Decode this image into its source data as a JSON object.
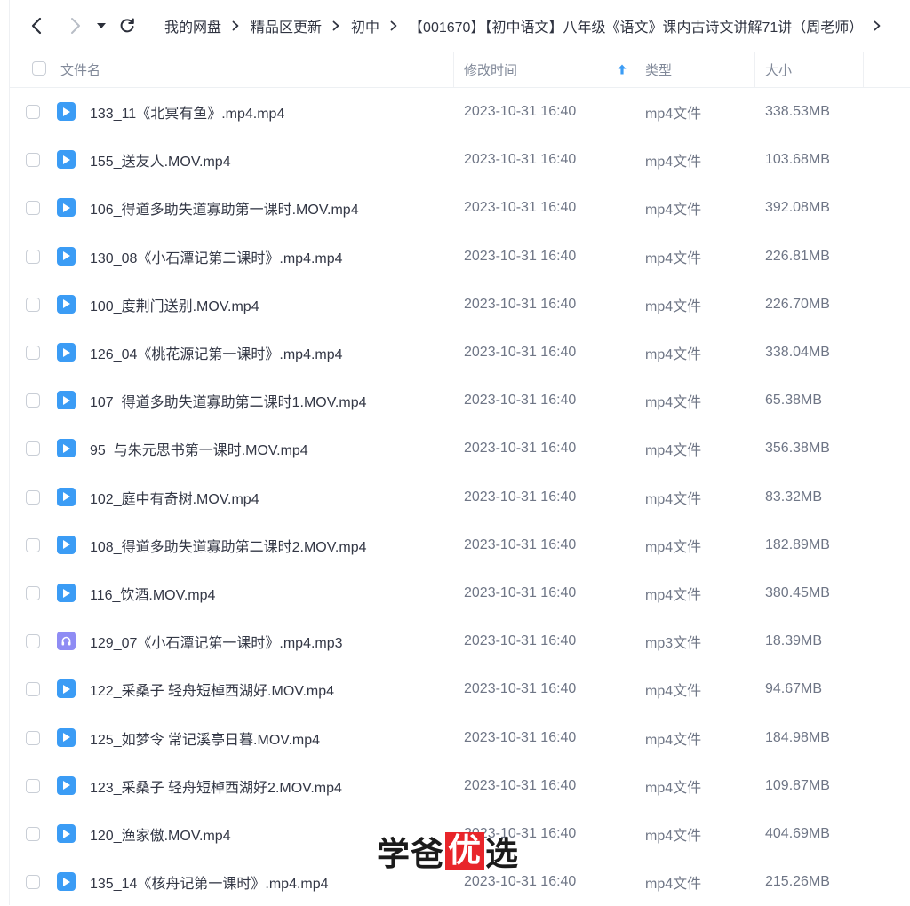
{
  "nav": {
    "breadcrumbs": [
      "我的网盘",
      "精品区更新",
      "初中",
      "【001670】【初中语文】八年级《语文》课内古诗文讲解71讲（周老师）"
    ]
  },
  "columns": {
    "name": "文件名",
    "modified": "修改时间",
    "type": "类型",
    "size": "大小"
  },
  "colors": {
    "video_icon": "#3b9cf5",
    "audio_icon": "#8f8cf4",
    "sort_arrow": "#3b9cf5",
    "watermark_highlight": "#e8252a"
  },
  "files": [
    {
      "name": "133_11《北冥有鱼》.mp4.mp4",
      "modified": "2023-10-31 16:40",
      "type": "mp4文件",
      "size": "338.53MB",
      "icon": "video-file-icon"
    },
    {
      "name": "155_送友人.MOV.mp4",
      "modified": "2023-10-31 16:40",
      "type": "mp4文件",
      "size": "103.68MB",
      "icon": "video-file-icon"
    },
    {
      "name": "106_得道多助失道寡助第一课时.MOV.mp4",
      "modified": "2023-10-31 16:40",
      "type": "mp4文件",
      "size": "392.08MB",
      "icon": "video-file-icon"
    },
    {
      "name": "130_08《小石潭记第二课时》.mp4.mp4",
      "modified": "2023-10-31 16:40",
      "type": "mp4文件",
      "size": "226.81MB",
      "icon": "video-file-icon"
    },
    {
      "name": "100_度荆门送别.MOV.mp4",
      "modified": "2023-10-31 16:40",
      "type": "mp4文件",
      "size": "226.70MB",
      "icon": "video-file-icon"
    },
    {
      "name": "126_04《桃花源记第一课时》.mp4.mp4",
      "modified": "2023-10-31 16:40",
      "type": "mp4文件",
      "size": "338.04MB",
      "icon": "video-file-icon"
    },
    {
      "name": "107_得道多助失道寡助第二课时1.MOV.mp4",
      "modified": "2023-10-31 16:40",
      "type": "mp4文件",
      "size": "65.38MB",
      "icon": "video-file-icon"
    },
    {
      "name": "95_与朱元思书第一课时.MOV.mp4",
      "modified": "2023-10-31 16:40",
      "type": "mp4文件",
      "size": "356.38MB",
      "icon": "video-file-icon"
    },
    {
      "name": "102_庭中有奇树.MOV.mp4",
      "modified": "2023-10-31 16:40",
      "type": "mp4文件",
      "size": "83.32MB",
      "icon": "video-file-icon"
    },
    {
      "name": "108_得道多助失道寡助第二课时2.MOV.mp4",
      "modified": "2023-10-31 16:40",
      "type": "mp4文件",
      "size": "182.89MB",
      "icon": "video-file-icon"
    },
    {
      "name": "116_饮酒.MOV.mp4",
      "modified": "2023-10-31 16:40",
      "type": "mp4文件",
      "size": "380.45MB",
      "icon": "video-file-icon"
    },
    {
      "name": "129_07《小石潭记第一课时》.mp4.mp3",
      "modified": "2023-10-31 16:40",
      "type": "mp3文件",
      "size": "18.39MB",
      "icon": "audio-file-icon"
    },
    {
      "name": "122_采桑子 轻舟短棹西湖好.MOV.mp4",
      "modified": "2023-10-31 16:40",
      "type": "mp4文件",
      "size": "94.67MB",
      "icon": "video-file-icon"
    },
    {
      "name": "125_如梦令 常记溪亭日暮.MOV.mp4",
      "modified": "2023-10-31 16:40",
      "type": "mp4文件",
      "size": "184.98MB",
      "icon": "video-file-icon"
    },
    {
      "name": "123_采桑子 轻舟短棹西湖好2.MOV.mp4",
      "modified": "2023-10-31 16:40",
      "type": "mp4文件",
      "size": "109.87MB",
      "icon": "video-file-icon"
    },
    {
      "name": "120_渔家傲.MOV.mp4",
      "modified": "2023-10-31 16:40",
      "type": "mp4文件",
      "size": "404.69MB",
      "icon": "video-file-icon"
    },
    {
      "name": "135_14《核舟记第一课时》.mp4.mp4",
      "modified": "2023-10-31 16:40",
      "type": "mp4文件",
      "size": "215.26MB",
      "icon": "video-file-icon"
    }
  ],
  "watermark": {
    "part1": "学爸",
    "highlight": "优",
    "part2": "选"
  }
}
